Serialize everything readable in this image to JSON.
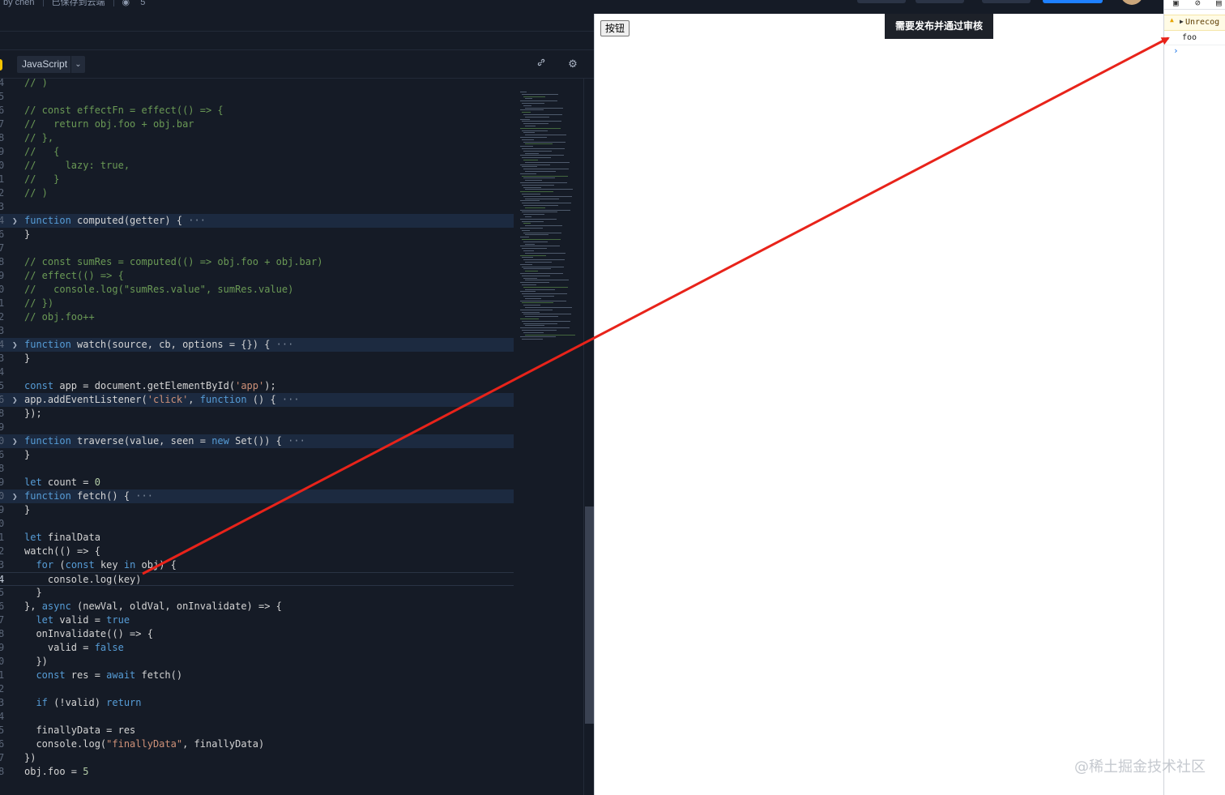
{
  "topbar": {
    "author": "by chen",
    "save_status": "已保存到云端",
    "views": "5"
  },
  "editor": {
    "language": "JavaScript",
    "chevron_icon": "chevron-down-icon",
    "tools": [
      "link-icon",
      "gear-icon"
    ],
    "lines": [
      {
        "n": "4",
        "t": "<span class=\"cm\">// )</span>"
      },
      {
        "n": "5",
        "t": ""
      },
      {
        "n": "6",
        "t": "<span class=\"cm\">// const effectFn = effect(() =&gt; {</span>"
      },
      {
        "n": "7",
        "t": "<span class=\"cm\">//   return obj.foo + obj.bar</span>"
      },
      {
        "n": "8",
        "t": "<span class=\"cm\">// },</span>"
      },
      {
        "n": "9",
        "t": "<span class=\"cm\">//   {</span>"
      },
      {
        "n": "0",
        "t": "<span class=\"cm\">//     lazy: true,</span>"
      },
      {
        "n": "1",
        "t": "<span class=\"cm\">//   }</span>"
      },
      {
        "n": "2",
        "t": "<span class=\"cm\">// )</span>"
      },
      {
        "n": "3",
        "t": ""
      },
      {
        "n": "4",
        "t": "<span class=\"kw\">function</span> computed(getter) { <span class=\"dots\">···</span>",
        "fold": true
      },
      {
        "n": "6",
        "t": "}"
      },
      {
        "n": "7",
        "t": ""
      },
      {
        "n": "8",
        "t": "<span class=\"cm\">// const sumRes = computed(() =&gt; obj.foo + obj.bar)</span>"
      },
      {
        "n": "9",
        "t": "<span class=\"cm\">// effect(() =&gt; {</span>"
      },
      {
        "n": "0",
        "t": "<span class=\"cm\">//   console.log(\"sumRes.value\", sumRes.value)</span>"
      },
      {
        "n": "1",
        "t": "<span class=\"cm\">// })</span>"
      },
      {
        "n": "2",
        "t": "<span class=\"cm\">// obj.foo++</span>"
      },
      {
        "n": "3",
        "t": ""
      },
      {
        "n": "4",
        "t": "<span class=\"kw\">function</span> watch(source, cb, options = {}) { <span class=\"dots\">···</span>",
        "fold": true
      },
      {
        "n": "3",
        "t": "}"
      },
      {
        "n": "4",
        "t": ""
      },
      {
        "n": "5",
        "t": "<span class=\"kw\">const</span> app = document.getElementById(<span class=\"st\">'app'</span>);"
      },
      {
        "n": "6",
        "t": "app.addEventListener(<span class=\"st\">'click'</span>, <span class=\"kw\">function</span> () { <span class=\"dots\">···</span>",
        "fold": true
      },
      {
        "n": "8",
        "t": "});"
      },
      {
        "n": "9",
        "t": ""
      },
      {
        "n": "0",
        "t": "<span class=\"kw\">function</span> traverse(value, seen = <span class=\"kw\">new</span> Set()) { <span class=\"dots\">···</span>",
        "fold": true
      },
      {
        "n": "6",
        "t": "}"
      },
      {
        "n": "8",
        "t": ""
      },
      {
        "n": "9",
        "t": "<span class=\"kw\">let</span> count = <span class=\"nm\">0</span>"
      },
      {
        "n": "0",
        "t": "<span class=\"kw\">function</span> fetch() { <span class=\"dots\">···</span>",
        "fold": true
      },
      {
        "n": "9",
        "t": "}"
      },
      {
        "n": "0",
        "t": ""
      },
      {
        "n": "1",
        "t": "<span class=\"kw\">let</span> finalData"
      },
      {
        "n": "2",
        "t": "watch(() =&gt; {"
      },
      {
        "n": "3",
        "t": "  <span class=\"kw\">for</span> (<span class=\"kw\">const</span> key <span class=\"kw\">in</span> obj) {"
      },
      {
        "n": "4",
        "t": "    console.log(key)",
        "current": true
      },
      {
        "n": "5",
        "t": "  }"
      },
      {
        "n": "6",
        "t": "}, <span class=\"kw\">async</span> (newVal, oldVal, onInvalidate) =&gt; {"
      },
      {
        "n": "7",
        "t": "  <span class=\"kw\">let</span> valid = <span class=\"kw\">true</span>"
      },
      {
        "n": "8",
        "t": "  onInvalidate(() =&gt; {"
      },
      {
        "n": "9",
        "t": "    valid = <span class=\"kw\">false</span>"
      },
      {
        "n": "0",
        "t": "  })"
      },
      {
        "n": "1",
        "t": "  <span class=\"kw\">const</span> res = <span class=\"kw\">await</span> fetch()"
      },
      {
        "n": "2",
        "t": ""
      },
      {
        "n": "3",
        "t": "  <span class=\"kw\">if</span> (!valid) <span class=\"kw\">return</span>"
      },
      {
        "n": "4",
        "t": ""
      },
      {
        "n": "5",
        "t": "  finallyData = res"
      },
      {
        "n": "6",
        "t": "  console.log(<span class=\"st\">\"finallyData\"</span>, finallyData)"
      },
      {
        "n": "7",
        "t": "})"
      },
      {
        "n": "8",
        "t": "obj.foo = <span class=\"nm\">5</span>"
      }
    ]
  },
  "preview": {
    "button_label": "按钮",
    "tooltip": "需要发布并通过审核"
  },
  "console": {
    "warning": "Unrecog",
    "log": "foo",
    "prompt": "›"
  },
  "watermark": "@稀土掘金技术社区",
  "colors": {
    "editor_bg": "#151b26",
    "comment": "#6a9955",
    "keyword": "#569cd6",
    "string": "#ce9178",
    "arrow": "#e8231a"
  }
}
